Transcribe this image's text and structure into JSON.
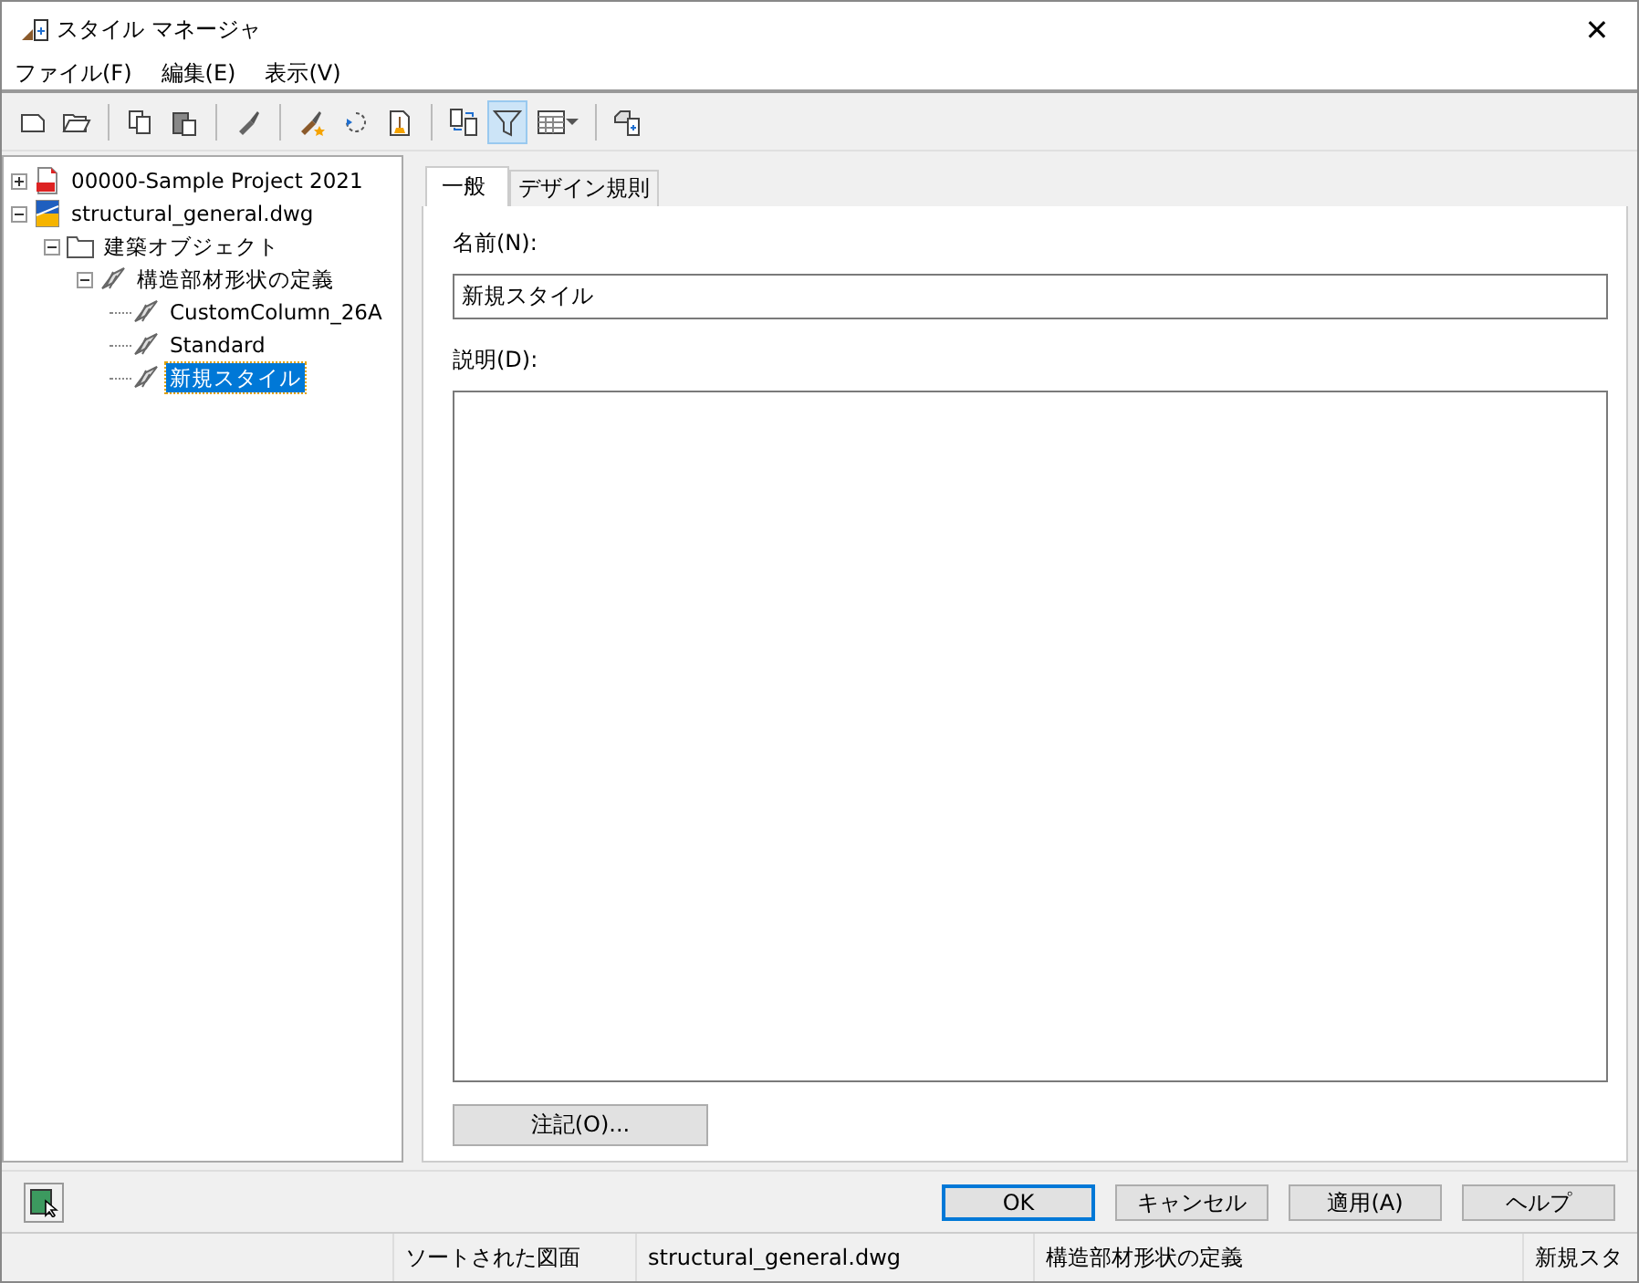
{
  "window": {
    "title": "スタイル マネージャ",
    "close": "✕"
  },
  "menu": [
    {
      "label": "ファイル(F)"
    },
    {
      "label": "編集(E)"
    },
    {
      "label": "表示(V)"
    }
  ],
  "toolbar": [
    {
      "kind": "new",
      "on": false
    },
    {
      "kind": "open",
      "on": false
    },
    {
      "kind": "sep"
    },
    {
      "kind": "copy",
      "on": false
    },
    {
      "kind": "paste",
      "on": false
    },
    {
      "kind": "sep"
    },
    {
      "kind": "brush",
      "on": false
    },
    {
      "kind": "sep"
    },
    {
      "kind": "brush-star",
      "on": false
    },
    {
      "kind": "cycle",
      "on": false
    },
    {
      "kind": "purge",
      "on": false
    },
    {
      "kind": "sep"
    },
    {
      "kind": "compare",
      "on": false
    },
    {
      "kind": "filter",
      "on": true
    },
    {
      "kind": "grid",
      "on": false
    },
    {
      "kind": "sep"
    },
    {
      "kind": "toggle",
      "on": false
    }
  ],
  "tree": [
    {
      "label": "00000-Sample Project 2021",
      "kind": "project",
      "expanded": false,
      "selected": false
    },
    {
      "label": "structural_general.dwg",
      "kind": "drawing",
      "expanded": true,
      "selected": false,
      "children": [
        {
          "label": "建築オブジェクト",
          "kind": "folder",
          "expanded": true,
          "selected": false,
          "children": [
            {
              "label": "構造部材形状の定義",
              "kind": "member",
              "expanded": true,
              "selected": false,
              "children": [
                {
                  "label": "CustomColumn_26A",
                  "kind": "member",
                  "selected": false
                },
                {
                  "label": "Standard",
                  "kind": "member",
                  "selected": false
                },
                {
                  "label": "新規スタイル",
                  "kind": "member",
                  "selected": true
                }
              ]
            }
          ]
        }
      ]
    }
  ],
  "tabs": [
    {
      "label": "一般",
      "selected": true
    },
    {
      "label": "デザイン規則",
      "selected": false
    }
  ],
  "name_field": {
    "label": "名前(N):",
    "value": "新規スタイル"
  },
  "description_field": {
    "label": "説明(D):"
  },
  "notes_button": "注記(O)...",
  "buttons": [
    {
      "label": "OK",
      "default": true
    },
    {
      "label": "キャンセル",
      "default": false
    },
    {
      "label": "適用(A)",
      "default": false
    },
    {
      "label": "ヘルプ",
      "default": false
    }
  ],
  "status_bar": [
    "ソートされた図面",
    "structural_general.dwg",
    "構造部材形状の定義",
    "新規スタ"
  ]
}
